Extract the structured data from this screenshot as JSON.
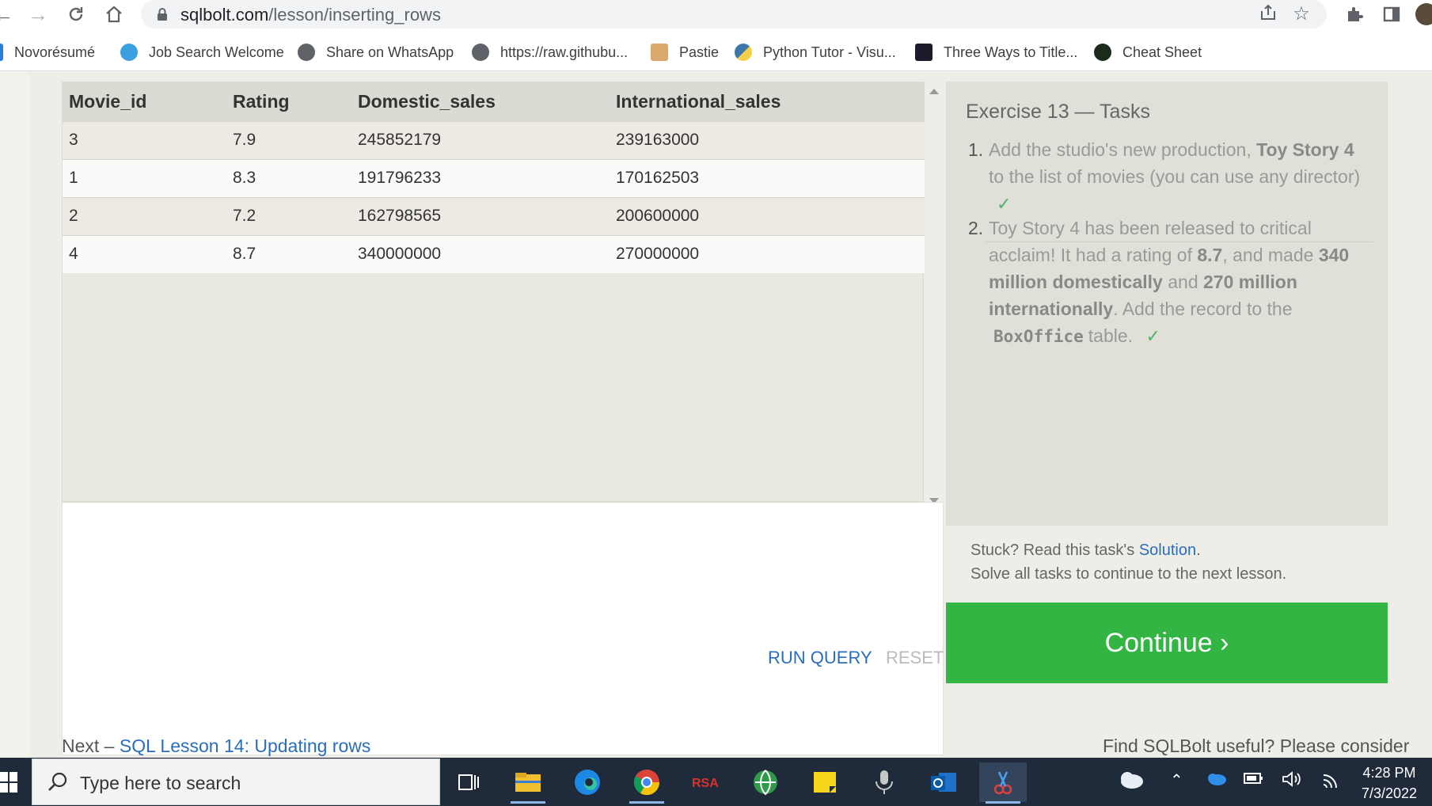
{
  "browser": {
    "url_host": "sqlbolt.com",
    "url_path": "/lesson/inserting_rows",
    "bookmarks": [
      {
        "label": "Novorésumé",
        "icon": "novoresume-icon"
      },
      {
        "label": "Job Search Welcome",
        "icon": "lightbulb-icon"
      },
      {
        "label": "Share on WhatsApp",
        "icon": "globe-icon"
      },
      {
        "label": "https://raw.githubu...",
        "icon": "globe-icon"
      },
      {
        "label": "Pastie",
        "icon": "clipboard-icon"
      },
      {
        "label": "Python Tutor - Visu...",
        "icon": "python-icon"
      },
      {
        "label": "Three Ways to Title...",
        "icon": "dark-square-icon"
      },
      {
        "label": "Cheat Sheet",
        "icon": "dark-leaf-icon"
      }
    ]
  },
  "results": {
    "columns": [
      "Movie_id",
      "Rating",
      "Domestic_sales",
      "International_sales"
    ],
    "rows": [
      [
        "3",
        "7.9",
        "245852179",
        "239163000"
      ],
      [
        "1",
        "8.3",
        "191796233",
        "170162503"
      ],
      [
        "2",
        "7.2",
        "162798565",
        "200600000"
      ],
      [
        "4",
        "8.7",
        "340000000",
        "270000000"
      ]
    ]
  },
  "editor": {
    "run_label": "RUN QUERY",
    "reset_label": "RESET"
  },
  "tasks": {
    "title": "Exercise 13 — Tasks",
    "task1": {
      "num": "1.",
      "a": "Add the studio's new production,",
      "bold": "Toy Story 4",
      "b": "to the list of movies (you can use any director)",
      "check": "✓"
    },
    "task2": {
      "num": "2.",
      "a": "Toy Story 4 has been released to critical acclaim! It had a rating of",
      "rating": "8.7",
      "b": ", and made",
      "domestic": "340 million domestically",
      "c": "and",
      "intl": "270 million internationally",
      "d": ". Add the record to the",
      "table": "BoxOffice",
      "e": "table.",
      "check": "✓"
    },
    "stuck_prefix": "Stuck? Read this task's",
    "solution_link": "Solution",
    "stuck_suffix": ".",
    "solve_all": "Solve all tasks to continue to the next lesson.",
    "continue_label": "Continue ›"
  },
  "footer": {
    "next_prefix": "Next –",
    "next_link": "SQL Lesson 14: Updating rows",
    "useful": "Find SQLBolt useful? Please consider"
  },
  "taskbar": {
    "search_placeholder": "Type here to search",
    "time": "4:28 PM",
    "date": "7/3/2022"
  },
  "colors": {
    "continue": "#33b544",
    "link": "#2a6ebb",
    "check": "#4fb36b",
    "taskbar": "#1f2a3a"
  }
}
